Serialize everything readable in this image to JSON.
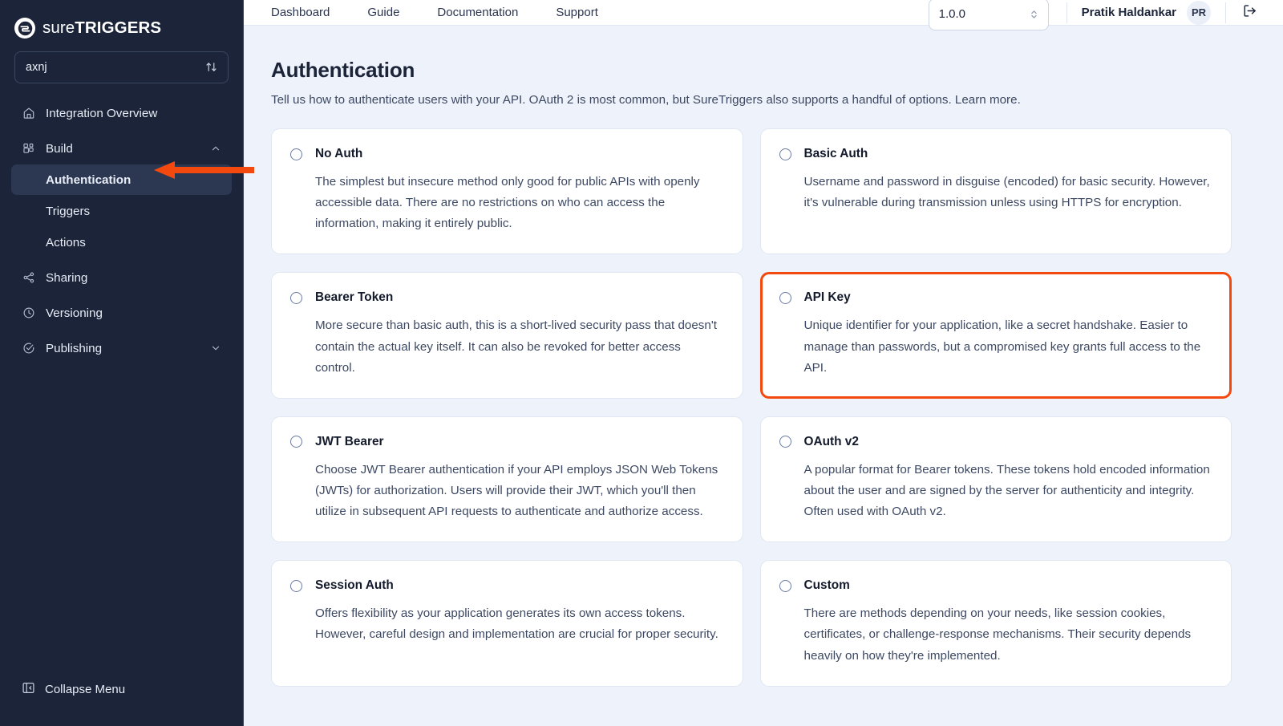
{
  "brand": {
    "name_light": "sure",
    "name_bold": "TRIGGERS",
    "logo_icon": "suretriggers-logo-icon"
  },
  "sidebar": {
    "search": {
      "value": "axnj",
      "icon": "sort-updown-icon"
    },
    "items": [
      {
        "label": "Integration Overview",
        "icon": "home-icon",
        "type": "link"
      },
      {
        "label": "Build",
        "icon": "blocks-icon",
        "type": "group",
        "chevron": "chevron-up-icon"
      },
      {
        "label": "Authentication",
        "type": "sub",
        "active": true
      },
      {
        "label": "Triggers",
        "type": "sub",
        "active": false
      },
      {
        "label": "Actions",
        "type": "sub",
        "active": false
      },
      {
        "label": "Sharing",
        "icon": "share-nodes-icon",
        "type": "link"
      },
      {
        "label": "Versioning",
        "icon": "clock-icon",
        "type": "link"
      },
      {
        "label": "Publishing",
        "icon": "check-circle-icon",
        "type": "group",
        "chevron": "chevron-down-icon"
      }
    ],
    "collapse": {
      "label": "Collapse Menu",
      "icon": "panel-collapse-icon"
    }
  },
  "topbar": {
    "nav": [
      {
        "label": "Dashboard"
      },
      {
        "label": "Guide"
      },
      {
        "label": "Documentation"
      },
      {
        "label": "Support"
      }
    ],
    "version": {
      "value": "1.0.0",
      "icon": "stepper-updown-icon"
    },
    "user": {
      "name": "Pratik Haldankar",
      "initials": "PR"
    },
    "logout_icon": "logout-icon"
  },
  "page": {
    "title": "Authentication",
    "subtitle": "Tell us how to authenticate users with your API. OAuth 2 is most common, but SureTriggers also supports a handful of options. Learn more."
  },
  "colors": {
    "sidebar_bg": "#1b2439",
    "content_bg": "#eef2fa",
    "accent_highlight": "#f4490e",
    "annotation_arrow": "#f4490e"
  },
  "annotation": {
    "arrow_target": "Authentication",
    "icon": "arrow-left-pointer"
  },
  "auth_options": [
    {
      "title": "No Auth",
      "description": "The simplest but insecure method only good for public APIs with openly accessible data. There are no restrictions on who can access the information, making it entirely public.",
      "selected": false
    },
    {
      "title": "Basic Auth",
      "description": "Username and password in disguise (encoded) for basic security. However, it's vulnerable during transmission unless using HTTPS for encryption.",
      "selected": false
    },
    {
      "title": "Bearer Token",
      "description": "More secure than basic auth, this is a short-lived security pass that doesn't contain the actual key itself. It can also be revoked for better access control.",
      "selected": false
    },
    {
      "title": "API Key",
      "description": "Unique identifier for your application, like a secret handshake. Easier to manage than passwords, but a compromised key grants full access to the API.",
      "selected": true
    },
    {
      "title": "JWT Bearer",
      "description": "Choose JWT Bearer authentication if your API employs JSON Web Tokens (JWTs) for authorization. Users will provide their JWT, which you'll then utilize in subsequent API requests to authenticate and authorize access.",
      "selected": false
    },
    {
      "title": "OAuth v2",
      "description": "A popular format for Bearer tokens. These tokens hold encoded information about the user and are signed by the server for authenticity and integrity. Often used with OAuth v2.",
      "selected": false
    },
    {
      "title": "Session Auth",
      "description": "Offers flexibility as your application generates its own access tokens. However, careful design and implementation are crucial for proper security.",
      "selected": false
    },
    {
      "title": "Custom",
      "description": "There are methods depending on your needs, like session cookies, certificates, or challenge-response mechanisms. Their security depends heavily on how they're implemented.",
      "selected": false
    }
  ]
}
